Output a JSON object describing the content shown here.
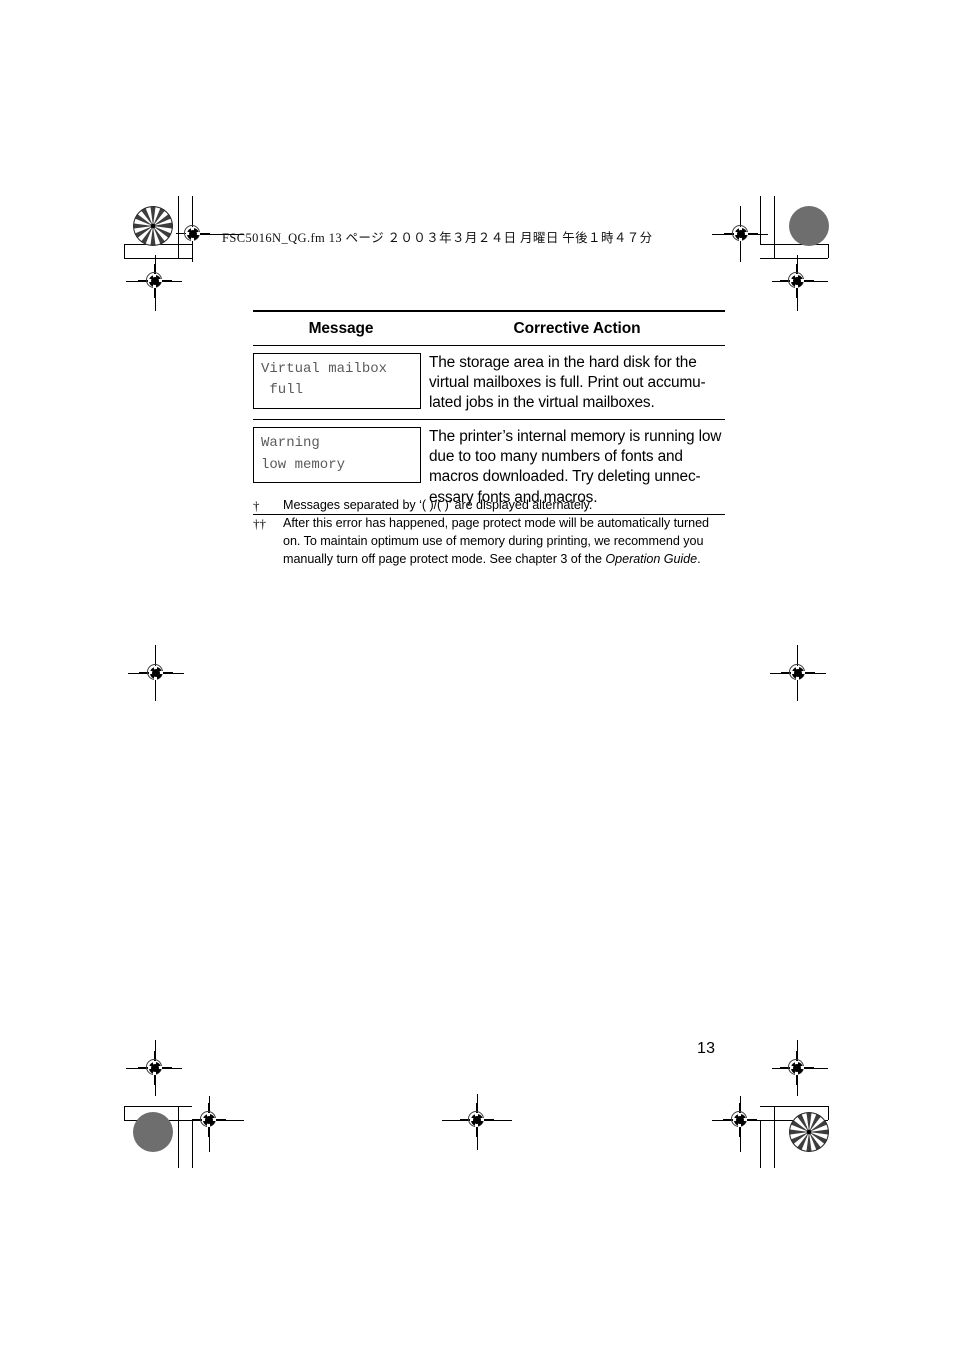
{
  "page": {
    "file_header": "FSC5016N_QG.fm  13 ページ  ２００３年３月２４日  月曜日  午後１時４７分",
    "page_number": "13"
  },
  "table": {
    "headers": {
      "message": "Message",
      "corrective_action": "Corrective Action"
    },
    "rows": [
      {
        "message": "Virtual mailbox\n full",
        "action": "The storage area in the hard disk for the virtual mailboxes is full. Print out accumu-lated jobs in the virtual mailboxes."
      },
      {
        "message": "Warning\nlow memory",
        "action": "The printer’s internal memory is running low due to too many numbers of fonts and macros downloaded. Try deleting unnec-essary fonts and macros."
      }
    ]
  },
  "footnotes": [
    {
      "marker": "†",
      "text": "Messages separated by ‘( )/( )’ are displayed alternately."
    },
    {
      "marker": "††",
      "text_before": "After this error has happened, page protect mode will be automatically turned on. To maintain optimum use of memory during printing, we recommend you manually turn off page protect mode. See chapter 3 of the ",
      "text_italic": "Operation Guide",
      "text_after": "."
    }
  ],
  "print_marks": {
    "star_target_label": "radial-resolution-target",
    "dot_target_label": "solid-density-dot",
    "registration_label": "registration-crosshair"
  }
}
